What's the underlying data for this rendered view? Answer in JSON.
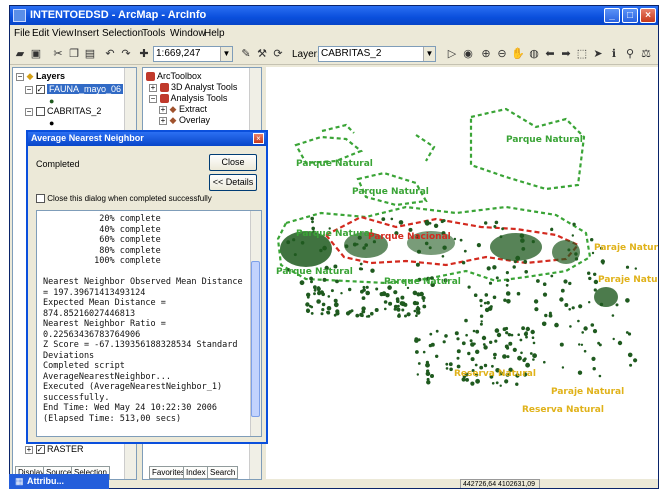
{
  "window": {
    "title": "INTENTOEDSD - ArcMap - ArcInfo"
  },
  "menu": [
    "File",
    "Edit",
    "View",
    "Insert",
    "Selection",
    "Tools",
    "Window",
    "Help"
  ],
  "toolbar": {
    "scale": "1:669,247",
    "layer_label": "Layer:",
    "layer_value": "CABRITAS_2"
  },
  "toc": {
    "root": "Layers",
    "layers": [
      {
        "name": "FAUNA_mayo_06",
        "checked": true,
        "selected": true
      },
      {
        "name": "CABRITAS_2",
        "checked": false,
        "selected": false
      }
    ],
    "bottom_layer": "RASTER",
    "tabs": [
      "Display",
      "Source",
      "Selection"
    ]
  },
  "arctoolbox": {
    "root": "ArcToolbox",
    "items": [
      "3D Analyst Tools",
      "Analysis Tools",
      "Extract",
      "Overlay"
    ],
    "tabs": [
      "Favorites",
      "Index",
      "Search"
    ]
  },
  "dialog": {
    "title": "Average Nearest Neighbor",
    "status": "Completed",
    "close_button": "Close",
    "details_button": "<< Details",
    "checkbox_label": "Close this dialog when completed successfully",
    "log": [
      "           20% complete",
      "           40% complete",
      "           60% complete",
      "           80% complete",
      "          100% complete",
      "",
      "Nearest Neighbor Observed Mean Distance",
      "= 197.39671413493124",
      "Expected Mean Distance =",
      "874.85216027446813",
      "Nearest Neighbor Ratio =",
      "0.22563436783764906",
      "Z Score = -67.139356188328534 Standard",
      "Deviations",
      "Completed script",
      "AverageNearestNeighbor...",
      "Executed (AverageNearestNeighbor_1)",
      "successfully.",
      "End Time: Wed May 24 10:22:30 2006",
      "(Elapsed Time: 513,00 secs)"
    ]
  },
  "map": {
    "labels": [
      {
        "text": "Parque Natural",
        "color": "green"
      },
      {
        "text": "Parque Natural",
        "color": "green"
      },
      {
        "text": "Parque Natural",
        "color": "green"
      },
      {
        "text": "Parque Natural",
        "color": "green"
      },
      {
        "text": "Parque Nacional",
        "color": "red"
      },
      {
        "text": "Parque Natural",
        "color": "green"
      },
      {
        "text": "Parque Natural",
        "color": "green"
      },
      {
        "text": "Paraje Natural",
        "color": "yellow"
      },
      {
        "text": "Paraje Natural",
        "color": "yellow"
      },
      {
        "text": "Reserva Natural",
        "color": "yellow"
      },
      {
        "text": "Paraje Natural",
        "color": "yellow"
      },
      {
        "text": "Reserva Natural",
        "color": "yellow"
      }
    ],
    "coordinates": "442726,64  4102631,09 Meters",
    "colors": {
      "natural_park": "#3aa436",
      "national_park": "#d32a1f",
      "paraje": "#e0b21a",
      "points": "#1f5a1f"
    }
  },
  "taskbar": {
    "item": "Attribu..."
  }
}
